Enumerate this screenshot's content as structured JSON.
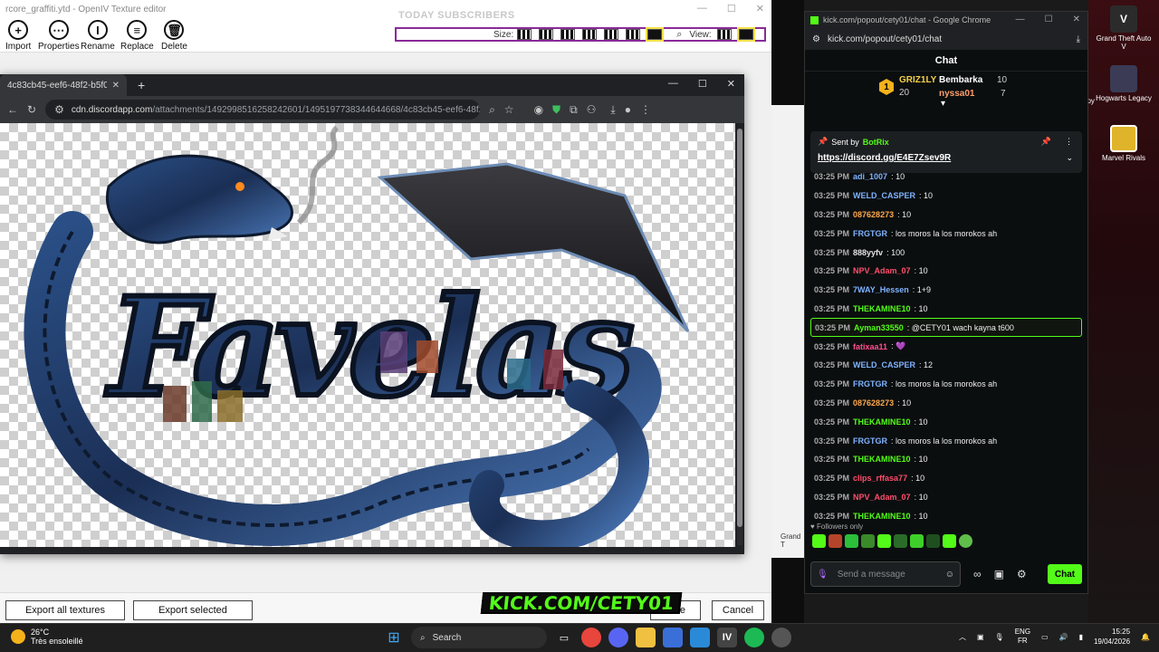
{
  "openiv": {
    "title": "rcore_graffiti.ytd - OpenIV Texture editor",
    "watermark": "TODAY SUBSCRIBERS",
    "toolbar": [
      {
        "label": "Import",
        "icon": "plus-icon"
      },
      {
        "label": "Properties",
        "icon": "dots-icon"
      },
      {
        "label": "Rename",
        "icon": "text-cursor-icon"
      },
      {
        "label": "Replace",
        "icon": "replace-icon"
      },
      {
        "label": "Delete",
        "icon": "trash-icon"
      }
    ],
    "size_label": "Size:",
    "view_label": "View:",
    "bottom_buttons": {
      "export_all": "Export all textures",
      "export_selected": "Export selected",
      "save_partial": "ve",
      "cancel": "Cancel"
    }
  },
  "image_window": {
    "tab_title": "4c83cb45-eef6-48f2-b5f0-794",
    "url_host": "cdn.discordapp.com",
    "url_path": "/attachments/1492998516258242601/1495197738344644668/4c83cb45-eef6-48f2-b5f0-...",
    "image_subject": "Favelas dragon graffiti logo"
  },
  "chrome_kick": {
    "window_title": "kick.com/popout/cety01/chat - Google Chrome",
    "address": "kick.com/popout/cety01/chat",
    "header": "Chat",
    "leaderboard": [
      {
        "rank": "1",
        "name": "GRIZ1LY",
        "count": "20"
      },
      {
        "name": "Bembarka",
        "count": "10"
      },
      {
        "name": "nyssa01",
        "count": "7"
      }
    ],
    "pinned": {
      "sent_by_label": "Sent by",
      "sender": "BotRix",
      "link": "https://discord.gg/E4E7Zsev9R"
    },
    "messages": [
      {
        "time": "03:25 PM",
        "user": "adi_1007",
        "color": "#7fb3ff",
        "text": ": 10"
      },
      {
        "time": "03:25 PM",
        "user": "WELD_CASPER",
        "color": "#7fb3ff",
        "text": ": 10"
      },
      {
        "time": "03:25 PM",
        "user": "087628273",
        "color": "#ffa94d",
        "text": ": 10"
      },
      {
        "time": "03:25 PM",
        "user": "FRGTGR",
        "color": "#7fb3ff",
        "text": ": los moros la los morokos ah"
      },
      {
        "time": "03:25 PM",
        "user": "888yyfv",
        "color": "#e0e0e0",
        "text": ": 100"
      },
      {
        "time": "03:25 PM",
        "user": "NPV_Adam_07",
        "color": "#ff4d6d",
        "text": ": 10"
      },
      {
        "time": "03:25 PM",
        "user": "7WAY_Hessen",
        "color": "#7fb3ff",
        "text": ": 1+9"
      },
      {
        "time": "03:25 PM",
        "user": "THEKAMINE10",
        "color": "#53fc18",
        "text": ": 10"
      },
      {
        "time": "03:25 PM",
        "user": "Ayman33550",
        "color": "#53fc18",
        "text": ": @CETY01 wach kayna t600",
        "highlight": true
      },
      {
        "time": "03:25 PM",
        "user": "fatixaa11",
        "color": "#ff4d8f",
        "text": ": 💜"
      },
      {
        "time": "03:25 PM",
        "user": "WELD_CASPER",
        "color": "#7fb3ff",
        "text": ": 12"
      },
      {
        "time": "03:25 PM",
        "user": "FRGTGR",
        "color": "#7fb3ff",
        "text": ": los moros la los morokos ah"
      },
      {
        "time": "03:25 PM",
        "user": "087628273",
        "color": "#ffa94d",
        "text": ": 10"
      },
      {
        "time": "03:25 PM",
        "user": "THEKAMINE10",
        "color": "#53fc18",
        "text": ": 10"
      },
      {
        "time": "03:25 PM",
        "user": "FRGTGR",
        "color": "#7fb3ff",
        "text": ": los moros la los morokos ah"
      },
      {
        "time": "03:25 PM",
        "user": "THEKAMINE10",
        "color": "#53fc18",
        "text": ": 10"
      },
      {
        "time": "03:25 PM",
        "user": "clips_rffasa77",
        "color": "#ff4d6d",
        "text": ": 10"
      },
      {
        "time": "03:25 PM",
        "user": "NPV_Adam_07",
        "color": "#ff4d6d",
        "text": ": 10"
      },
      {
        "time": "03:25 PM",
        "user": "THEKAMINE10",
        "color": "#53fc18",
        "text": ": 10"
      }
    ],
    "followers_only": "Followers only",
    "input_placeholder": "Send a message",
    "chat_button": "Chat"
  },
  "desktop_icons": [
    {
      "label": "Grand Theft Auto V",
      "color": "#2b2b2b"
    },
    {
      "label": "Hogwarts Legacy",
      "color": "#3b3b55"
    },
    {
      "label": "Marvel Rivals",
      "color": "#e0b42a"
    }
  ],
  "side_labels": {
    "copy": "opy",
    "grand": "Grand T"
  },
  "overlay_banner": "KICK.COM/CETY01",
  "taskbar": {
    "weather_temp": "26°C",
    "weather_desc": "Très ensoleillé",
    "search": "Search",
    "lang_top": "ENG",
    "lang_bottom": "FR",
    "time": "15:25",
    "date": "19/04/2026"
  },
  "colors": {
    "kick_green": "#53fc18",
    "size_border": "#8a2a9a"
  }
}
